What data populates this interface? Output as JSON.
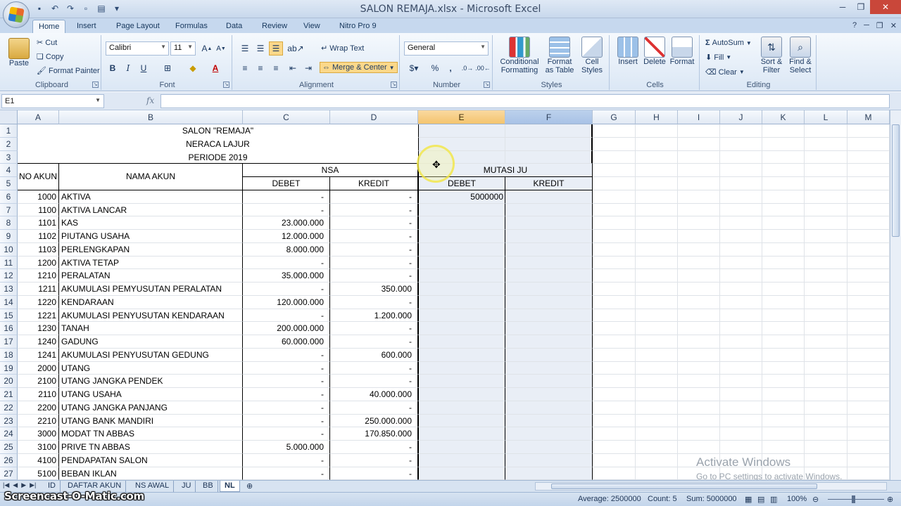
{
  "window": {
    "title": "SALON REMAJA.xlsx - Microsoft Excel"
  },
  "ribbon_tabs": [
    "Home",
    "Insert",
    "Page Layout",
    "Formulas",
    "Data",
    "Review",
    "View",
    "Nitro Pro 9"
  ],
  "clipboard": {
    "paste": "Paste",
    "cut": "Cut",
    "copy": "Copy",
    "format_painter": "Format Painter",
    "label": "Clipboard"
  },
  "font": {
    "name": "Calibri",
    "size": "11",
    "label": "Font",
    "bold": "B",
    "italic": "I",
    "underline": "U"
  },
  "alignment": {
    "wrap_text": "Wrap Text",
    "merge_center": "Merge & Center",
    "label": "Alignment"
  },
  "number": {
    "format": "General",
    "percent": "%",
    "comma": ",",
    "label": "Number"
  },
  "styles": {
    "conditional_1": "Conditional",
    "conditional_2": "Formatting",
    "table_1": "Format",
    "table_2": "as Table",
    "cell_1": "Cell",
    "cell_2": "Styles",
    "label": "Styles"
  },
  "cells": {
    "insert": "Insert",
    "delete": "Delete",
    "format": "Format",
    "label": "Cells"
  },
  "editing": {
    "autosum": "AutoSum",
    "fill": "Fill",
    "clear": "Clear",
    "sort_1": "Sort &",
    "sort_2": "Filter",
    "find_1": "Find &",
    "find_2": "Select",
    "label": "Editing"
  },
  "formula_bar": {
    "name_box": "E1",
    "fx": "fx",
    "content": ""
  },
  "columns": [
    "A",
    "B",
    "C",
    "D",
    "E",
    "F",
    "G",
    "H",
    "I",
    "J",
    "K",
    "L",
    "M"
  ],
  "sheet": {
    "title1": "SALON \"REMAJA\"",
    "title2": "NERACA LAJUR",
    "title3": "PERIODE 2019",
    "hdr_no_akun": "NO AKUN",
    "hdr_nama_akun": "NAMA AKUN",
    "hdr_nsa": "NSA",
    "hdr_mutasi": "MUTASI JU",
    "hdr_debet": "DEBET",
    "hdr_kredit": "KREDIT",
    "rows": [
      {
        "r": "6",
        "no": "1000",
        "nama": "AKTIVA",
        "debet": "-",
        "kredit": "-",
        "e": "5000000"
      },
      {
        "r": "7",
        "no": "1100",
        "nama": "AKTIVA LANCAR",
        "debet": "-",
        "kredit": "-",
        "e": ""
      },
      {
        "r": "8",
        "no": "1101",
        "nama": "KAS",
        "debet": "23.000.000",
        "kredit": "-",
        "e": ""
      },
      {
        "r": "9",
        "no": "1102",
        "nama": "PIUTANG USAHA",
        "debet": "12.000.000",
        "kredit": "-",
        "e": ""
      },
      {
        "r": "10",
        "no": "1103",
        "nama": "PERLENGKAPAN",
        "debet": "8.000.000",
        "kredit": "-",
        "e": ""
      },
      {
        "r": "11",
        "no": "1200",
        "nama": "AKTIVA TETAP",
        "debet": "-",
        "kredit": "-",
        "e": ""
      },
      {
        "r": "12",
        "no": "1210",
        "nama": "PERALATAN",
        "debet": "35.000.000",
        "kredit": "-",
        "e": ""
      },
      {
        "r": "13",
        "no": "1211",
        "nama": "AKUMULASI PEMYUSUTAN PERALATAN",
        "debet": "-",
        "kredit": "350.000",
        "e": ""
      },
      {
        "r": "14",
        "no": "1220",
        "nama": "KENDARAAN",
        "debet": "120.000.000",
        "kredit": "-",
        "e": ""
      },
      {
        "r": "15",
        "no": "1221",
        "nama": "AKUMULASI PENYUSUTAN KENDARAAN",
        "debet": "-",
        "kredit": "1.200.000",
        "e": ""
      },
      {
        "r": "16",
        "no": "1230",
        "nama": "TANAH",
        "debet": "200.000.000",
        "kredit": "-",
        "e": ""
      },
      {
        "r": "17",
        "no": "1240",
        "nama": "GADUNG",
        "debet": "60.000.000",
        "kredit": "-",
        "e": ""
      },
      {
        "r": "18",
        "no": "1241",
        "nama": "AKUMULASI PENYUSUTAN GEDUNG",
        "debet": "-",
        "kredit": "600.000",
        "e": ""
      },
      {
        "r": "19",
        "no": "2000",
        "nama": "UTANG",
        "debet": "-",
        "kredit": "-",
        "e": ""
      },
      {
        "r": "20",
        "no": "2100",
        "nama": "UTANG JANGKA PENDEK",
        "debet": "-",
        "kredit": "-",
        "e": ""
      },
      {
        "r": "21",
        "no": "2110",
        "nama": "UTANG USAHA",
        "debet": "-",
        "kredit": "40.000.000",
        "e": ""
      },
      {
        "r": "22",
        "no": "2200",
        "nama": "UTANG JANGKA PANJANG",
        "debet": "-",
        "kredit": "-",
        "e": ""
      },
      {
        "r": "23",
        "no": "2210",
        "nama": "UTANG BANK MANDIRI",
        "debet": "-",
        "kredit": "250.000.000",
        "e": ""
      },
      {
        "r": "24",
        "no": "3000",
        "nama": "MODAT TN ABBAS",
        "debet": "-",
        "kredit": "170.850.000",
        "e": ""
      },
      {
        "r": "25",
        "no": "3100",
        "nama": "PRIVE TN ABBAS",
        "debet": "5.000.000",
        "kredit": "-",
        "e": ""
      },
      {
        "r": "26",
        "no": "4100",
        "nama": "PENDAPATAN SALON",
        "debet": "-",
        "kredit": "-",
        "e": ""
      },
      {
        "r": "27",
        "no": "5100",
        "nama": "BEBAN IKLAN",
        "debet": "-",
        "kredit": "-",
        "e": ""
      }
    ]
  },
  "sheet_tabs": [
    "ID",
    "DAFTAR AKUN",
    "NS AWAL",
    "JU",
    "BB",
    "NL"
  ],
  "active_sheet": "NL",
  "status": {
    "average": "Average: 2500000",
    "count": "Count: 5",
    "sum": "Sum: 5000000",
    "zoom": "100%"
  },
  "watermark": "Screencast-O-Matic.com",
  "activate": {
    "line1": "Activate Windows",
    "line2": "Go to PC settings to activate Windows."
  }
}
